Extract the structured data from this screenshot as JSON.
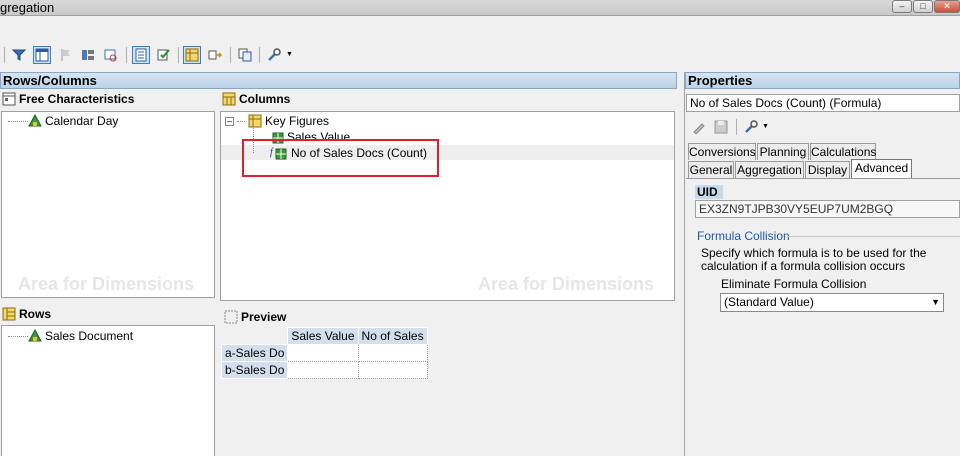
{
  "window": {
    "title": "gregation"
  },
  "rows_columns": {
    "header": "Rows/Columns",
    "free_characteristics": {
      "title": "Free Characteristics",
      "items": [
        "Calendar Day"
      ],
      "watermark": "Area for Dimensions"
    },
    "columns": {
      "title": "Columns",
      "tree_root": "Key Figures",
      "items": [
        "Sales Value",
        "No of Sales Docs (Count)"
      ],
      "watermark": "Area for Dimensions"
    },
    "rows": {
      "title": "Rows",
      "items": [
        "Sales Document"
      ]
    },
    "preview": {
      "title": "Preview",
      "column_headers": [
        "Sales Value",
        "No of Sales"
      ],
      "row_headers": [
        "a-Sales Do",
        "b-Sales Do"
      ]
    }
  },
  "properties": {
    "header": "Properties",
    "selected_object": "No of Sales Docs (Count) (Formula)",
    "tabs_row1": [
      "Conversions",
      "Planning",
      "Calculations"
    ],
    "tabs_row2": [
      "General",
      "Aggregation",
      "Display",
      "Advanced"
    ],
    "active_tab": "Advanced",
    "uid_label": "UID",
    "uid_value": "EX3ZN9TJPB30VY5EUP7UM2BGQ",
    "formula_collision_link": "Formula Collision",
    "formula_collision_desc_line1": "Specify which formula is to be used for the",
    "formula_collision_desc_line2": "calculation if a formula collision occurs",
    "eliminate_label": "Eliminate Formula Collision",
    "eliminate_value": "(Standard Value)"
  },
  "colors": {
    "highlight_box": "#e0202a",
    "panel_header": "#c9d9ea",
    "link": "#1b57b7"
  }
}
